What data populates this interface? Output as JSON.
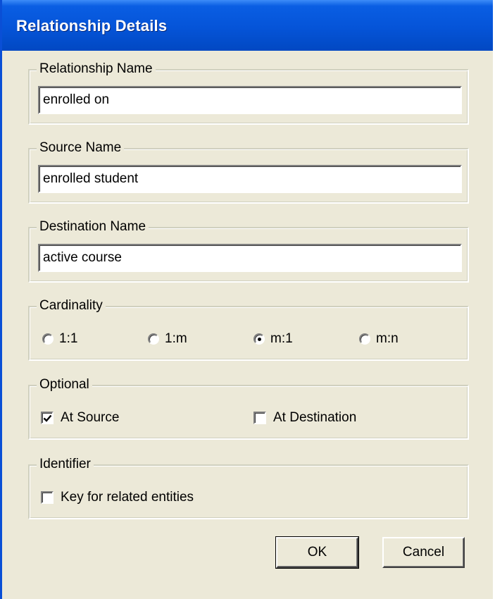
{
  "window": {
    "title": "Relationship Details"
  },
  "relationship_name": {
    "label": "Relationship Name",
    "value": "enrolled on"
  },
  "source_name": {
    "label": "Source Name",
    "value": "enrolled student"
  },
  "destination_name": {
    "label": "Destination Name",
    "value": "active course"
  },
  "cardinality": {
    "label": "Cardinality",
    "options": [
      "1:1",
      "1:m",
      "m:1",
      "m:n"
    ],
    "selected": "m:1"
  },
  "optional": {
    "label": "Optional",
    "at_source": {
      "label": "At Source",
      "checked": true
    },
    "at_destination": {
      "label": "At Destination",
      "checked": false
    }
  },
  "identifier": {
    "label": "Identifier",
    "key_related": {
      "label": "Key for related entities",
      "checked": false
    }
  },
  "buttons": {
    "ok": "OK",
    "cancel": "Cancel"
  }
}
